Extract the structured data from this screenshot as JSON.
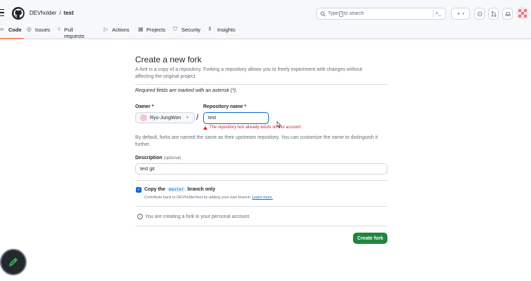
{
  "header": {
    "owner": "DEVholder",
    "separator": "/",
    "repo": "test",
    "search": {
      "prefix": "Type",
      "key": "/",
      "suffix": "to search",
      "command_glyph": ">_"
    },
    "plus_label": "+",
    "caret": "▾"
  },
  "nav": {
    "tabs": [
      {
        "label": "Code",
        "icon": "code-icon"
      },
      {
        "label": "Issues",
        "icon": "issue-opened-icon"
      },
      {
        "label": "Pull requests",
        "icon": "git-pull-request-icon"
      },
      {
        "label": "Actions",
        "icon": "play-icon"
      },
      {
        "label": "Projects",
        "icon": "table-icon"
      },
      {
        "label": "Security",
        "icon": "shield-icon"
      },
      {
        "label": "Insights",
        "icon": "graph-icon"
      }
    ]
  },
  "form": {
    "title": "Create a new fork",
    "description_italic": "fork",
    "description_before": "A ",
    "description_after": " is a copy of a repository. Forking a repository allows you to freely experiment with changes without affecting the original project.",
    "required_note": "Required fields are marked with an asterisk (*).",
    "owner_label": "Owner *",
    "owner_value": "Ryu-JungWon",
    "owner_caret": "▾",
    "slash": "/",
    "repo_name_label": "Repository name *",
    "repo_name_value": "test",
    "error_message": "The repository test already exists on this account.",
    "default_note": "By default, forks are named the same as their upstream repository. You can customize the name to distinguish it further.",
    "description_label": "Description",
    "description_optional": "(optional)",
    "description_value": "test git",
    "copy_checked": true,
    "checkmark": "✓",
    "copy_before": "Copy the",
    "copy_branch": "master",
    "copy_after": "branch only",
    "contrib_text": "Contribute back to DEVholder/test by adding your own branch.",
    "learn_more": "Learn more.",
    "info_glyph": "i",
    "info_text": "You are creating a fork in your personal account.",
    "submit_label": "Create fork"
  },
  "colors": {
    "primary_green": "#1f883d",
    "focus_blue": "#0969da",
    "error_red": "#d1242f",
    "active_tab_underline": "#fd8c73"
  }
}
